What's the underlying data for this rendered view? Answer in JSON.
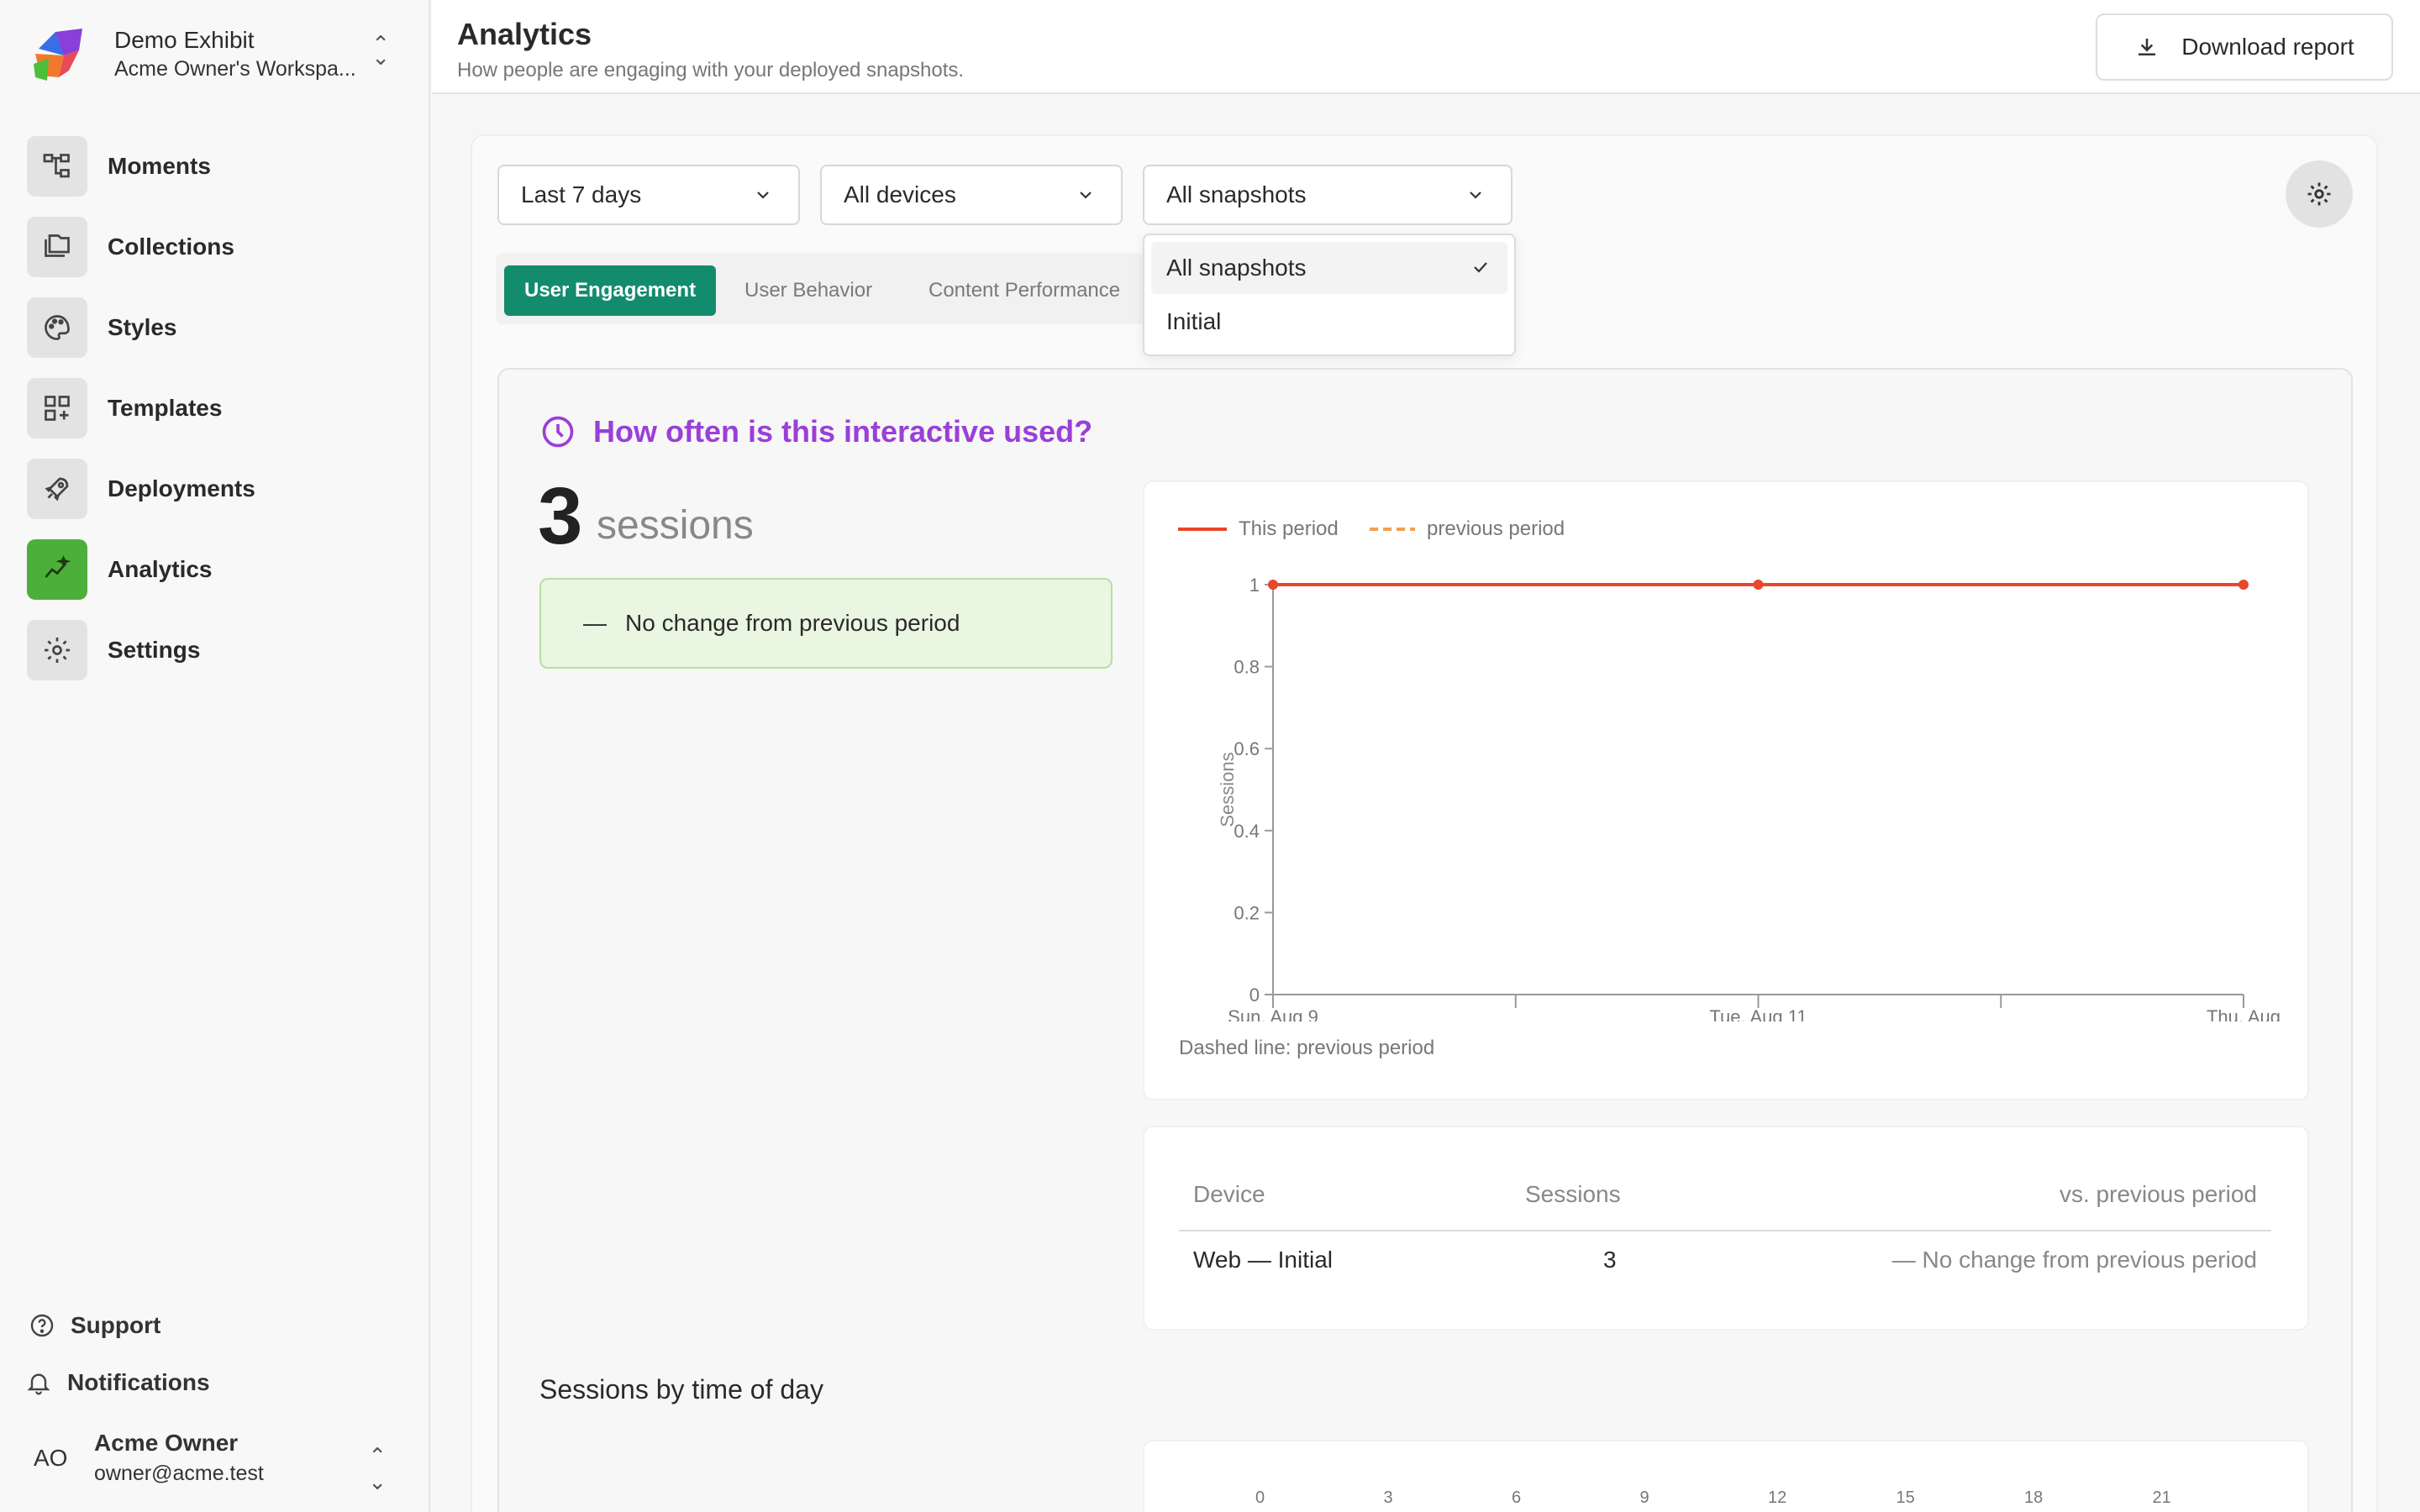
{
  "workspace": {
    "name": "Demo Exhibit",
    "sub": "Acme Owner's Workspa..."
  },
  "nav": [
    {
      "label": "Moments",
      "icon": "moments-icon"
    },
    {
      "label": "Collections",
      "icon": "collections-icon"
    },
    {
      "label": "Styles",
      "icon": "palette-icon"
    },
    {
      "label": "Templates",
      "icon": "templates-icon"
    },
    {
      "label": "Deployments",
      "icon": "rocket-icon"
    },
    {
      "label": "Analytics",
      "icon": "analytics-icon",
      "active": true
    },
    {
      "label": "Settings",
      "icon": "gear-icon"
    }
  ],
  "bottom": {
    "support": "Support",
    "notifications": "Notifications"
  },
  "user": {
    "initials": "AO",
    "name": "Acme Owner",
    "email": "owner@acme.test"
  },
  "header": {
    "title": "Analytics",
    "subtitle": "How people are engaging with your deployed snapshots.",
    "download": "Download report"
  },
  "filters": {
    "period": "Last 7 days",
    "devices": "All devices",
    "snapshots": "All snapshots"
  },
  "tabs": [
    "User Engagement",
    "User Behavior",
    "Content Performance"
  ],
  "dropdown": {
    "items": [
      "All snapshots",
      "Initial"
    ],
    "selected": "All snapshots"
  },
  "engagement": {
    "question": "How often is this interactive used?",
    "count": "3",
    "unit": "sessions",
    "change": "No change from previous period",
    "change_prefix": "—"
  },
  "chart_data": {
    "type": "line",
    "legend": [
      "This period",
      "previous period"
    ],
    "ylabel": "Sessions",
    "xlabel": "",
    "ylim": [
      0,
      1
    ],
    "yticks": [
      "0",
      "0.2",
      "0.4",
      "0.6",
      "0.8",
      "1"
    ],
    "x": [
      "Sun, Aug 9",
      "Tue, Aug 11",
      "Thu, Aug"
    ],
    "series": [
      {
        "name": "This period",
        "values": [
          1,
          1,
          1
        ]
      }
    ],
    "note": "Dashed line: previous period",
    "colors": {
      "this": "#e8472a",
      "prev": "#f0a050"
    }
  },
  "table": {
    "headers": [
      "Device",
      "Sessions",
      "vs. previous period"
    ],
    "rows": [
      {
        "device": "Web — Initial",
        "sessions": "3",
        "change": "— No change from previous period"
      }
    ]
  },
  "time_of_day": {
    "title": "Sessions by time of day",
    "ticks": [
      "0",
      "3",
      "6",
      "9",
      "12",
      "15",
      "18",
      "21"
    ]
  }
}
